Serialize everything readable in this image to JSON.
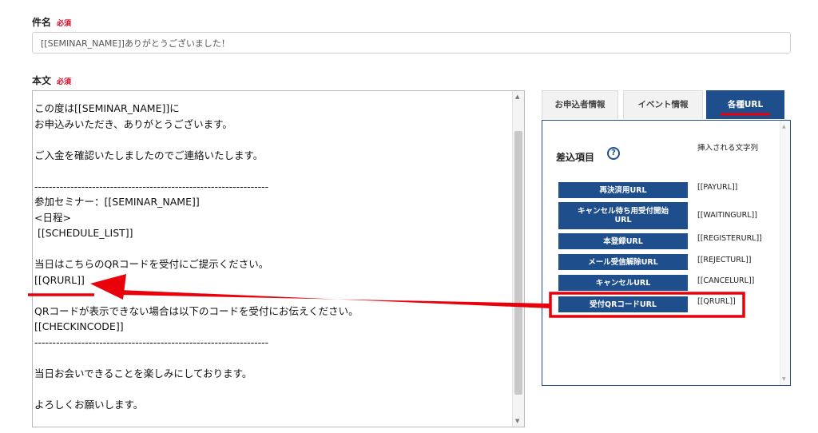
{
  "subject": {
    "label": "件名",
    "required": "必須",
    "value": "[[SEMINAR_NAME]]ありがとうございました！"
  },
  "body": {
    "label": "本文",
    "required": "必須",
    "text": "この度は[[SEMINAR_NAME]]に\nお申込みいただき、ありがとうございます。\n\nご入金を確認いたしましたのでご連絡いたします。\n\n-----------------------------------------------------------------\n参加セミナー：[[SEMINAR_NAME]]\n<日程>\n [[SCHEDULE_LIST]]\n\n当日はこちらのQRコードを受付にご提示ください。\n[[QRURL]]\n\nQRコードが表示できない場合は以下のコードを受付にお伝えください。\n[[CHECKINCODE]]\n-----------------------------------------------------------------\n\n当日お会いできることを楽しみにしております。\n\nよろしくお願いします。"
  },
  "tabs": [
    {
      "label": "お申込者情報"
    },
    {
      "label": "イベント情報"
    },
    {
      "label": "各種URL"
    }
  ],
  "panel": {
    "title": "差込項目",
    "help_icon": "?",
    "column_header": "挿入される文字列",
    "items": [
      {
        "button": "再決済用URL",
        "code": "[[PAYURL]]"
      },
      {
        "button": "キャンセル待ち用受付開始URL",
        "code": "[[WAITINGURL]]"
      },
      {
        "button": "本登録URL",
        "code": "[[REGISTERURL]]"
      },
      {
        "button": "メール受信解除URL",
        "code": "[[REJECTURL]]"
      },
      {
        "button": "キャンセルURL",
        "code": "[[CANCELURL]]"
      },
      {
        "button": "受付QRコードURL",
        "code": "[[QRURL]]"
      }
    ]
  },
  "colors": {
    "accent": "#1f4e8c",
    "required": "#d0021b",
    "annotation": "#e8000b"
  }
}
